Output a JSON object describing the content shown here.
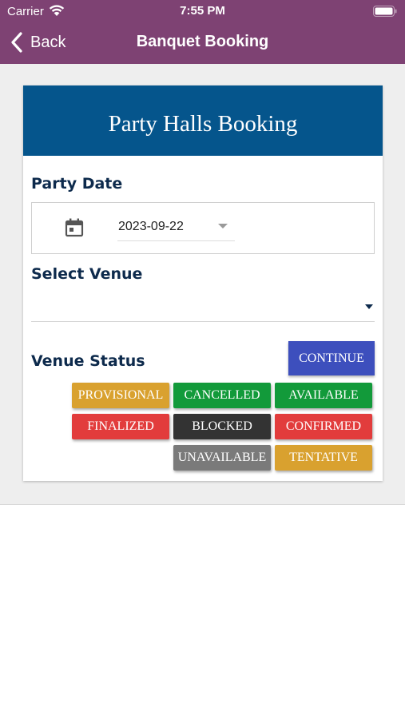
{
  "status_bar": {
    "carrier": "Carrier",
    "time": "7:55 PM"
  },
  "nav": {
    "back_label": "Back",
    "title": "Banquet Booking"
  },
  "card": {
    "title": "Party Halls Booking",
    "party_date_label": "Party Date",
    "party_date_value": "2023-09-22",
    "select_venue_label": "Select Venue",
    "select_venue_value": "",
    "venue_status_label": "Venue Status",
    "continue_label": "CONTINUE"
  },
  "status_legend": [
    {
      "label": "PROVISIONAL",
      "color": "#d9a12f"
    },
    {
      "label": "CANCELLED",
      "color": "#129a3a"
    },
    {
      "label": "AVAILABLE",
      "color": "#129a3a"
    },
    {
      "label": "FINALIZED",
      "color": "#e23c3c"
    },
    {
      "label": "BLOCKED",
      "color": "#333333"
    },
    {
      "label": "CONFIRMED",
      "color": "#e23c3c"
    },
    {
      "label": "UNAVAILABLE",
      "color": "#7a7a7a"
    },
    {
      "label": "TENTATIVE",
      "color": "#d9a12f"
    }
  ],
  "icons": {
    "wifi": "wifi-icon",
    "battery": "battery-icon",
    "back": "chevron-left-icon",
    "calendar": "calendar-icon",
    "dropdown": "caret-down-icon"
  }
}
